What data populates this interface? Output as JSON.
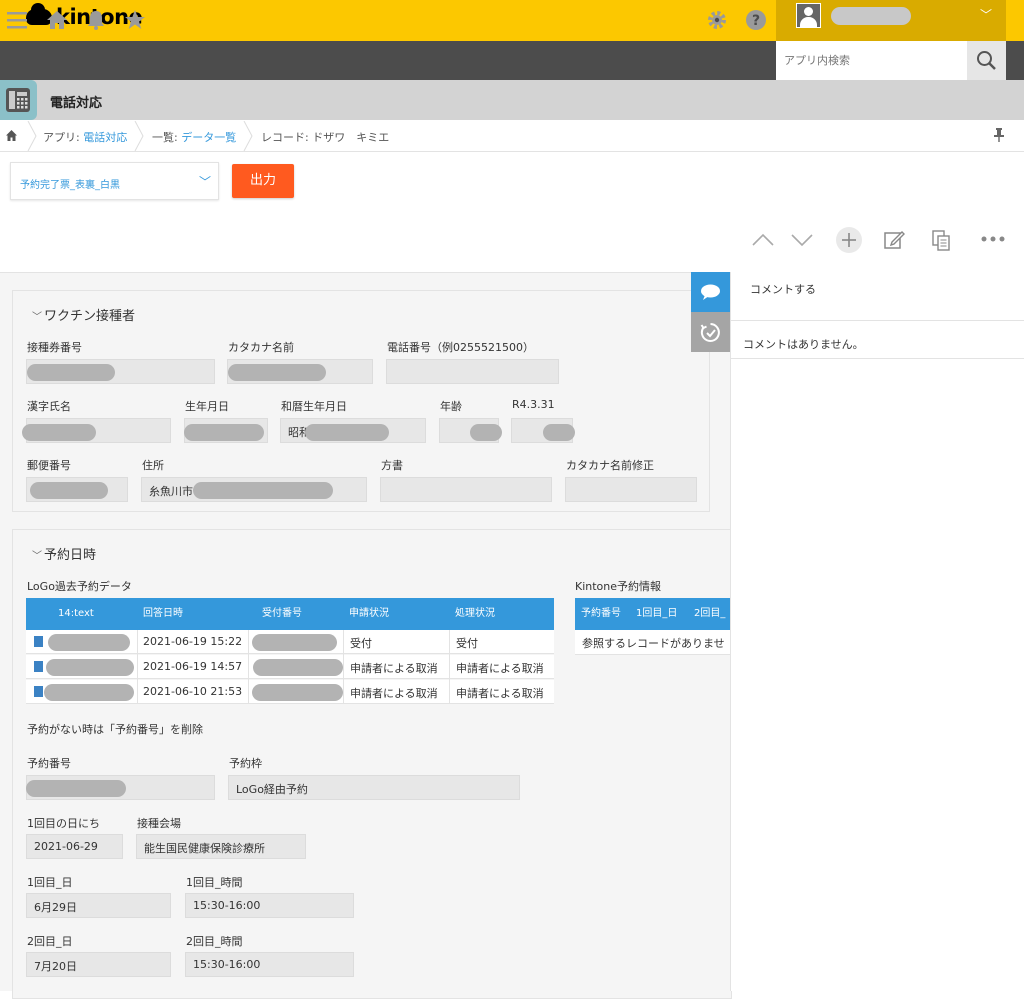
{
  "header": {
    "logo_text": "kintone",
    "search_placeholder": "アプリ内検索"
  },
  "app": {
    "title": "電話対応"
  },
  "breadcrumb": {
    "app_prefix": "アプリ: ",
    "app_name": "電話対応",
    "view_prefix": "一覧: ",
    "view_name": "データ一覧",
    "record_label": "レコード: ドザワ　キミエ"
  },
  "actions": {
    "template_value": "予約完了票_表裏_白黒",
    "print_label": "出力"
  },
  "group_vaccinee": {
    "title": "ワクチン接種者",
    "labels": {
      "ticket_no": "接種券番号",
      "kana_name": "カタカナ名前",
      "phone": "電話番号（例0255521500）",
      "kanji_name": "漢字氏名",
      "birthday": "生年月日",
      "wareki_birthday": "和暦生年月日",
      "age": "年齢",
      "age_ref": "R4.3.31",
      "postal": "郵便番号",
      "address": "住所",
      "care_of": "方書",
      "kana_fix": "カタカナ名前修正"
    },
    "values": {
      "wareki_prefix": "昭和",
      "address_prefix": "糸魚川市"
    }
  },
  "group_reservation": {
    "title": "予約日時",
    "logo_table_title": "LoGo過去予約データ",
    "logo_columns": [
      "14:text",
      "回答日時",
      "受付番号",
      "申請状況",
      "処理状況"
    ],
    "logo_rows": [
      {
        "datetime": "2021-06-19 15:22",
        "apply": "受付",
        "process": "受付"
      },
      {
        "datetime": "2021-06-19 14:57",
        "apply": "申請者による取消",
        "process": "申請者による取消"
      },
      {
        "datetime": "2021-06-10 21:53",
        "apply": "申請者による取消",
        "process": "申請者による取消"
      }
    ],
    "kintone_table_title": "Kintone予約情報",
    "kintone_columns": [
      "予約番号",
      "1回目_日",
      "2回目_"
    ],
    "kintone_empty": "参照するレコードがありませ",
    "note": "予約がない時は「予約番号」を削除",
    "labels": {
      "reservation_no": "予約番号",
      "slot": "予約枠",
      "first_date": "1回目の日にち",
      "venue": "接種会場",
      "first_day": "1回目_日",
      "first_time": "1回目_時間",
      "second_day": "2回目_日",
      "second_time": "2回目_時間"
    },
    "values": {
      "slot": "LoGo経由予約",
      "first_date": "2021-06-29",
      "venue": "能生国民健康保険診療所",
      "first_day": "6月29日",
      "first_time": "15:30-16:00",
      "second_day": "7月20日",
      "second_time": "15:30-16:00"
    }
  },
  "side": {
    "comment_placeholder": "コメントする",
    "no_comments": "コメントはありません。"
  },
  "colors": {
    "header_yellow": "#fcc800",
    "toolbar_dark": "#4c4c4c",
    "accent_blue": "#3498db",
    "print_orange": "#ff5a1f"
  }
}
